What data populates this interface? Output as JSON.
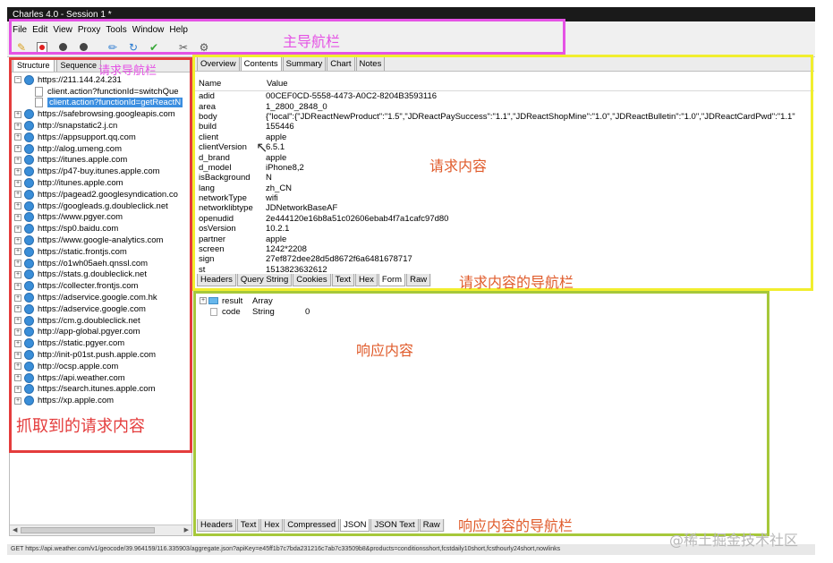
{
  "window": {
    "title": "Charles 4.0 - Session 1 *"
  },
  "menu": [
    "File",
    "Edit",
    "View",
    "Proxy",
    "Tools",
    "Window",
    "Help"
  ],
  "toolbar_icons": [
    "broom-icon",
    "record-icon",
    "throttle-icon",
    "breakpoint-icon",
    "pen-icon",
    "refresh-icon",
    "check-icon",
    "tools-icon",
    "settings-icon"
  ],
  "left_tabs": [
    "Structure",
    "Sequence"
  ],
  "tree": [
    {
      "label": "https://211.144.24.231",
      "expanded": true
    },
    {
      "label": "client.action?functionId=switchQue",
      "child": true
    },
    {
      "label": "client.action?functionId=getReactN",
      "child": true,
      "selected": true
    },
    {
      "label": "https://safebrowsing.googleapis.com"
    },
    {
      "label": "http://snapstatic2.j.cn"
    },
    {
      "label": "https://appsupport.qq.com"
    },
    {
      "label": "http://alog.umeng.com"
    },
    {
      "label": "https://itunes.apple.com"
    },
    {
      "label": "https://p47-buy.itunes.apple.com"
    },
    {
      "label": "http://itunes.apple.com"
    },
    {
      "label": "https://pagead2.googlesyndication.co"
    },
    {
      "label": "https://googleads.g.doubleclick.net"
    },
    {
      "label": "https://www.pgyer.com"
    },
    {
      "label": "https://sp0.baidu.com"
    },
    {
      "label": "https://www.google-analytics.com"
    },
    {
      "label": "https://static.frontjs.com"
    },
    {
      "label": "https://o1wh05aeh.qnssl.com"
    },
    {
      "label": "https://stats.g.doubleclick.net"
    },
    {
      "label": "https://collecter.frontjs.com"
    },
    {
      "label": "https://adservice.google.com.hk"
    },
    {
      "label": "https://adservice.google.com"
    },
    {
      "label": "https://cm.g.doubleclick.net"
    },
    {
      "label": "http://app-global.pgyer.com"
    },
    {
      "label": "https://static.pgyer.com"
    },
    {
      "label": "http://init-p01st.push.apple.com"
    },
    {
      "label": "http://ocsp.apple.com"
    },
    {
      "label": "https://api.weather.com"
    },
    {
      "label": "https://search.itunes.apple.com"
    },
    {
      "label": "https://xp.apple.com"
    }
  ],
  "top_tabs": [
    "Overview",
    "Contents",
    "Summary",
    "Chart",
    "Notes"
  ],
  "table": {
    "headers": [
      "Name",
      "Value"
    ],
    "rows": [
      [
        "adid",
        "00CEF0CD-5558-4473-A0C2-8204B3593116"
      ],
      [
        "area",
        "1_2800_2848_0"
      ],
      [
        "body",
        "{\"local\":{\"JDReactNewProduct\":\"1.5\",\"JDReactPaySuccess\":\"1.1\",\"JDReactShopMine\":\"1.0\",\"JDReactBulletin\":\"1.0\",\"JDReactCardPwd\":\"1.1\""
      ],
      [
        "build",
        "155446"
      ],
      [
        "client",
        "apple"
      ],
      [
        "clientVersion",
        "6.5.1"
      ],
      [
        "d_brand",
        "apple"
      ],
      [
        "d_model",
        "iPhone8,2"
      ],
      [
        "isBackground",
        "N"
      ],
      [
        "lang",
        "zh_CN"
      ],
      [
        "networkType",
        "wifi"
      ],
      [
        "networklibtype",
        "JDNetworkBaseAF"
      ],
      [
        "openudid",
        "2e444120e16b8a51c02606ebab4f7a1cafc97d80"
      ],
      [
        "osVersion",
        "10.2.1"
      ],
      [
        "partner",
        "apple"
      ],
      [
        "screen",
        "1242*2208"
      ],
      [
        "sign",
        "27ef872dee28d5d8672f6a6481678717"
      ],
      [
        "st",
        "1513823632612"
      ]
    ]
  },
  "request_tabs": [
    "Headers",
    "Query String",
    "Cookies",
    "Text",
    "Hex",
    "Form",
    "Raw"
  ],
  "request_active": "Form",
  "json_tree": [
    {
      "key": "result",
      "type": "Array",
      "value": ""
    },
    {
      "key": "code",
      "type": "String",
      "value": "0"
    }
  ],
  "response_tabs": [
    "Headers",
    "Text",
    "Hex",
    "Compressed",
    "JSON",
    "JSON Text",
    "Raw"
  ],
  "response_active": "JSON",
  "status": "GET https://api.weather.com/v1/geocode/39.964159/116.335903/aggregate.json?apiKey=e45ff1b7c7bda231216c7ab7c33509b8&products=conditionsshort,fcstdaily10short,fcsthourly24short,nowlinks",
  "annotations": {
    "main_nav": "主导航栏",
    "request_nav": "请求导航栏",
    "captured": "抓取到的请求内容",
    "request_content": "请求内容",
    "request_content_nav": "请求内容的导航栏",
    "response_content": "响应内容",
    "response_content_nav": "响应内容的导航栏"
  },
  "watermark": "@稀土掘金技术社区"
}
